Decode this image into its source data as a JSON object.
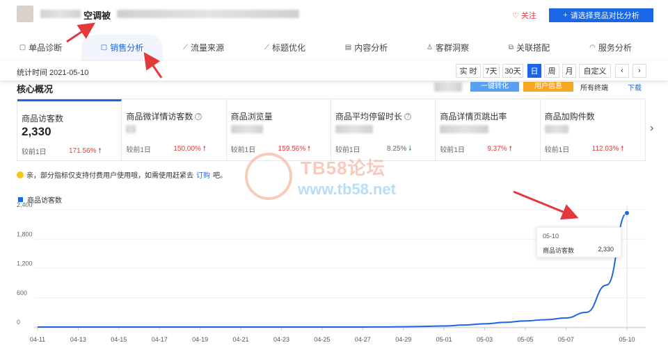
{
  "header": {
    "product_title": "空调被",
    "follow_label": "关注",
    "compare_button": "请选择竞品对比分析"
  },
  "tabs": [
    {
      "label": "单品诊断",
      "icon": "shopping-bag-icon"
    },
    {
      "label": "销售分析",
      "icon": "shopping-bag-icon",
      "active": true
    },
    {
      "label": "流量来源",
      "icon": "line-chart-icon"
    },
    {
      "label": "标题优化",
      "icon": "line-chart-icon"
    },
    {
      "label": "内容分析",
      "icon": "document-icon"
    },
    {
      "label": "客群洞察",
      "icon": "user-icon"
    },
    {
      "label": "关联搭配",
      "icon": "link-icon"
    },
    {
      "label": "服务分析",
      "icon": "headset-icon"
    }
  ],
  "timebar": {
    "stat_time": "统计时间 2021-05-10",
    "buttons": [
      "实 时",
      "7天",
      "30天",
      "日",
      "周",
      "月",
      "自定义"
    ],
    "active_button": "日"
  },
  "core": {
    "title": "核心概况",
    "btn_blue": "一键转化",
    "btn_orange": "用户信息",
    "terminal": "所有终端",
    "download": "下载"
  },
  "metrics": [
    {
      "label": "商品访客数",
      "value": "2,330",
      "compare": "较前1日",
      "pct": "171.56%",
      "trend": "up",
      "help": false
    },
    {
      "label": "商品微详情访客数",
      "value": "",
      "compare": "较前1日",
      "pct": "150.00%",
      "trend": "up",
      "help": true
    },
    {
      "label": "商品浏览量",
      "value": "",
      "compare": "较前1日",
      "pct": "159.56%",
      "trend": "up",
      "help": false
    },
    {
      "label": "商品平均停留时长",
      "value": "",
      "compare": "较前1日",
      "pct": "8.25%",
      "trend": "down",
      "help": true
    },
    {
      "label": "商品详情页跳出率",
      "value": "",
      "compare": "较前1日",
      "pct": "9.37%",
      "trend": "up",
      "help": false
    },
    {
      "label": "商品加购件数",
      "value": "",
      "compare": "较前1日",
      "pct": "112.03%",
      "trend": "up",
      "help": false
    }
  ],
  "notice": {
    "text": "亲，部分指标仅支持付费用户使用哦，如需使用赶紧去",
    "link": "订购",
    "suffix": "吧。"
  },
  "watermark": {
    "line1": "TB58论坛",
    "line2": "www.tb58.net"
  },
  "chart_data": {
    "type": "line",
    "series": [
      {
        "name": "商品访客数",
        "color": "#1a66e6"
      }
    ],
    "x": [
      "04-11",
      "04-12",
      "04-13",
      "04-14",
      "04-15",
      "04-16",
      "04-17",
      "04-18",
      "04-19",
      "04-20",
      "04-21",
      "04-22",
      "04-23",
      "04-24",
      "04-25",
      "04-26",
      "04-27",
      "04-28",
      "04-29",
      "04-30",
      "05-01",
      "05-02",
      "05-03",
      "05-04",
      "05-05",
      "05-06",
      "05-07",
      "05-08",
      "05-09",
      "05-10"
    ],
    "values": [
      0,
      0,
      0,
      0,
      0,
      0,
      0,
      0,
      0,
      0,
      0,
      0,
      0,
      0,
      0,
      0,
      0,
      2,
      5,
      12,
      22,
      40,
      65,
      95,
      125,
      150,
      185,
      300,
      858,
      2330
    ],
    "x_tick_labels": [
      "04-11",
      "04-13",
      "04-15",
      "04-17",
      "04-19",
      "04-21",
      "04-23",
      "04-25",
      "04-27",
      "04-29",
      "05-01",
      "05-03",
      "05-05",
      "05-07",
      "05-10"
    ],
    "y_ticks": [
      "0",
      "600",
      "1,200",
      "1,800",
      "2,400"
    ],
    "ylim": [
      0,
      2400
    ],
    "grid": true,
    "legend": "top-left"
  },
  "tooltip": {
    "date": "05-10",
    "label": "商品访客数",
    "value": "2,330"
  }
}
